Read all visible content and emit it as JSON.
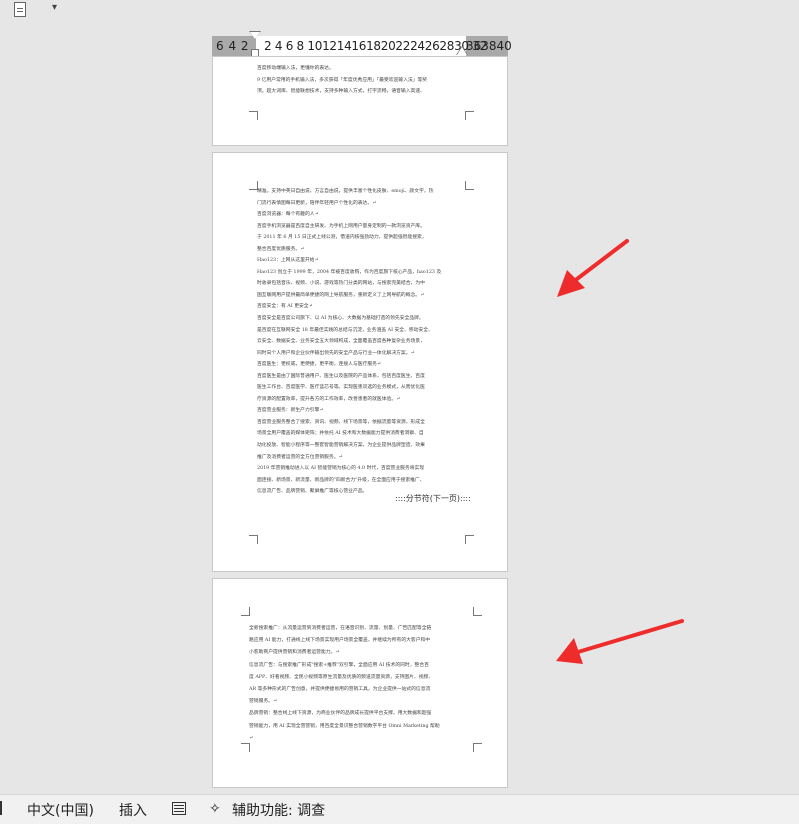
{
  "ruler": {
    "left_numbers": "6  4  2",
    "middle_numbers": "2  4  6  8 1012141618202224262830 32",
    "right_numbers": "363840"
  },
  "page1": {
    "lines": [
      "百度移动端输入法，更懂你的表达。",
      "9 亿用户常用的手机输入法，多次获得「年度优秀应用」「最受欢迎输入法」等奖",
      "项。超大词库、智能联想技术，支持多种输入方式，打字流畅，语音输入高速、"
    ]
  },
  "page2": {
    "lines": [
      "精准。支持中英日自由说、方言自由说，提供丰富个性化皮肤、emoji、颜文字，热",
      "门流行表情图每日更新，陪伴年轻用户个性化的表达。↵",
      "百度浏览器：每个有趣的人↵",
      "百度手机浏览器是百度自主研发、为手机上网用户量身定制的一款浏览资产库。",
      "于 2011 年 6 月 15 日正式上线公测，借道内核强劲动力，提供超强智能搜索，",
      "整合百度优质服务。↵",
      "Hao123：上网从这里开始↵",
      "Hao123 创立于 1999 年，2004 年被百度收购，作为百度旗下核心产品，hao123 及",
      "时收录包括音乐、视频、小说、游戏等热门分类的网站，与搜索完美结合，为中",
      "国互联网用户提供最简单便捷的网上导航服务，重新定义了上网导航的概念。↵",
      "百度安全：有 AI 更安全↵",
      "百度安全是百度公司旗下、以 AI 为核心、大数据为基础打造的领先安全品牌。",
      "是百度在互联网安全 18 年最佳实践的总结与沉淀，业务涵盖 AI 安全、移动安全、",
      "云安全、数据安全、业务安全五大领域构成，全面覆盖百度各种复杂业务场景，",
      "同时向个人用户和企业伙伴输出领先的安全产品与行业一体化解决方案。↵",
      "百度医生：更权威，更便捷，更平衡，连接人与医疗服务↵",
      "百度医生是由了国际普通用户、医生以及医院的产品体系，包括百度医生、百度",
      "医生工作台、百度医学、医疗蓝芯号等。实现医患双选的业务模式，从而优化医",
      "疗资源的配置效率，提升各方的工作效率，改善患者的就医体验。↵",
      "百度营业服务：新生产力引擎↵",
      "百度营业服务整合了搜索、资讯、视频、线下场景等，依据流量等资源，形成全",
      "场景全用户覆盖的媒体矩阵；并依托 AI 技术和大数据能力提供消费者洞察、自",
      "动化投放、智能小程序等一整套智能营销解决方案，为企业提供品牌塑造、效果",
      "推广及消费者运营的全方位营销服务。↵",
      "2019 年营销推动进入以 AI 智能营销为核心的 4.0 时代，百度营业服务将实现",
      "面连接、新场景、新流量、新品牌的\"四新合力\"升级，在全面应用于搜索推广、",
      "信息流广告、品牌营销、聚屏推广等核心营业产品。"
    ],
    "section_break": "分节符(下一页)"
  },
  "page3": {
    "lines": [
      "全新搜索推广：从流量运营到消费者运营，在语音识别、流量、划量、广告匹配等全链",
      "路应用 AI 能力，打通线上线下场景实现用户场景全覆盖，并继续为所有的大客户和中",
      "小客助商户提供营销和消费者运营能力。↵",
      "信息流广告：与搜索推广形成\"搜索+推荐\"双引擎，全面应用 AI 技术的同时，整合百",
      "度 APP、好看视频、全民小视频等原生流量及优质的频道流量资源，支持图片、视频、",
      "AR 等多种形式的广告创意，并提供便捷易用的营销工具，为企业提供一站式的信息流",
      "营销服务。↵",
      "品牌营销：整合线上线下资源，为商业伙伴的品牌成长提供平台支撑，用大数据和超强",
      "营销能力，用 AI 实现全营营销，用百度全景识整合营销数字平台 Omni Marketing 帮助",
      "↵"
    ]
  },
  "statusbar": {
    "language": "中文(中国)",
    "mode": "插入",
    "accessibility": "辅助功能: 调查"
  },
  "colors": {
    "arrow": "#ee2c2c",
    "background": "#e6e6e6",
    "ruler_gray": "#a9a9a9"
  }
}
